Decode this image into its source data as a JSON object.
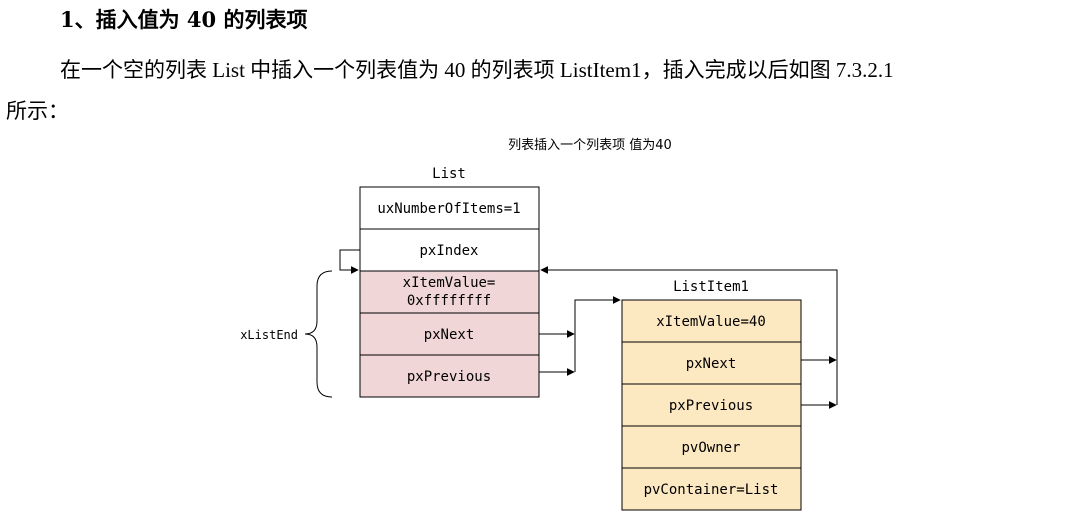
{
  "heading": "1、插入值为 40 的列表项",
  "paragraph_line1": "在一个空的列表 List 中插入一个列表值为 40 的列表项 ListItem1，插入完成以后如图 7.3.2.1",
  "paragraph_line2": "所示：",
  "diagram": {
    "caption": "列表插入一个列表项 值为40",
    "list_label": "List",
    "list_fields": {
      "number_of_items": "uxNumberOfItems=1",
      "index": "pxIndex",
      "end_value_line1": "xItemValue=",
      "end_value_line2": "0xffffffff",
      "end_next": "pxNext",
      "end_previous": "pxPrevious"
    },
    "list_end_label": "xListEnd",
    "item_label": "ListItem1",
    "item_fields": {
      "value": "xItemValue=40",
      "next": "pxNext",
      "previous": "pxPrevious",
      "owner": "pvOwner",
      "container": "pvContainer=List"
    },
    "colors": {
      "list_fill": "#ffffff",
      "list_end_fill": "#f0d6d6",
      "item_fill": "#fce9c2",
      "stroke": "#000000"
    }
  }
}
